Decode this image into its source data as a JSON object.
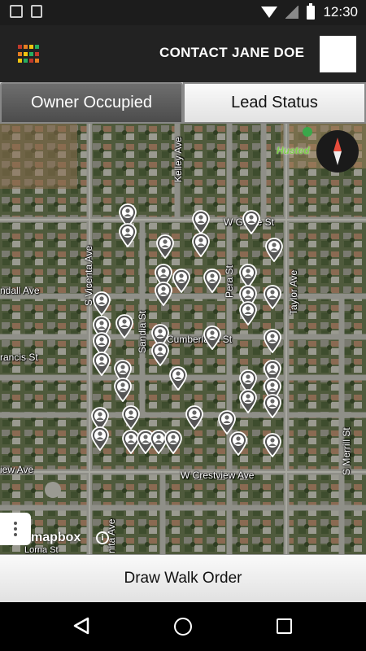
{
  "status_bar": {
    "time": "12:30",
    "icons": [
      "image-notification-icon",
      "document-notification-icon",
      "wifi-icon",
      "no-signal-icon",
      "battery-icon"
    ]
  },
  "app_bar": {
    "menu_icon": "grid-menu-icon",
    "contact_label": "CONTACT JANE DOE",
    "grid_colors": [
      "#c0392b",
      "#e67e22",
      "#f1c40f",
      "#27ae60"
    ]
  },
  "tabs": [
    {
      "label": "Owner Occupied",
      "active": true
    },
    {
      "label": "Lead Status",
      "active": false
    }
  ],
  "map": {
    "streets": {
      "w_grove": "W Grove St",
      "kelley": "Kelley Ave",
      "s_vicenta": "S Vicenta Ave",
      "pera": "Pera St",
      "taylor": "Taylor Ave",
      "sandia": "Sandia St",
      "cumberland": "Cumberland St",
      "w_crestview": "W Crestview Ave",
      "s_merrill": "S Merrill St",
      "randall_ave": "ndall Ave",
      "francis_st": "rancis St",
      "view_ave": "iew Ave",
      "lorna": "Lorna St",
      "anita": "nita Ave"
    },
    "place": "Husted",
    "attribution": "mapbox",
    "info_symbol": "i",
    "compass_icon": "compass-icon",
    "menu_icon": "more-vertical-icon",
    "pin_icon": "person-pin-icon",
    "pin_count": 49
  },
  "bottom_button": {
    "label": "Draw Walk Order"
  },
  "nav_bar": {
    "icons": [
      "back-icon",
      "home-icon",
      "recent-apps-icon"
    ]
  }
}
